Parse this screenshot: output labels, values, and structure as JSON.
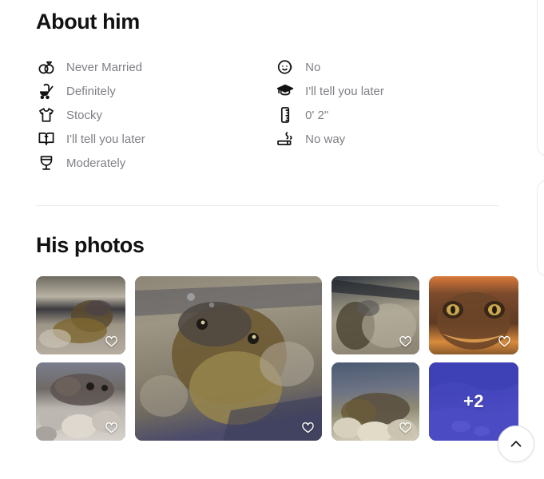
{
  "about": {
    "title": "About him",
    "facts_left": [
      {
        "icon": "wedding-rings-icon",
        "label": "Never Married"
      },
      {
        "icon": "stroller-icon",
        "label": "Definitely"
      },
      {
        "icon": "tshirt-icon",
        "label": "Stocky"
      },
      {
        "icon": "open-book-icon",
        "label": "I'll tell you later"
      },
      {
        "icon": "wine-glass-icon",
        "label": "Moderately"
      }
    ],
    "facts_right": [
      {
        "icon": "baby-face-icon",
        "label": "No"
      },
      {
        "icon": "graduation-cap-icon",
        "label": "I'll tell you later"
      },
      {
        "icon": "ruler-icon",
        "label": "0' 2\""
      },
      {
        "icon": "cigarette-icon",
        "label": "No way"
      }
    ]
  },
  "photos": {
    "title": "His photos",
    "items": [
      {
        "name": "photo-1",
        "alt": "frog in tank",
        "like": "heart-icon"
      },
      {
        "name": "photo-2-large",
        "alt": "close up frog head",
        "like": "heart-icon"
      },
      {
        "name": "photo-3",
        "alt": "frog near gravel",
        "like": "heart-icon"
      },
      {
        "name": "photo-4",
        "alt": "orange toad face",
        "like": "heart-icon"
      },
      {
        "name": "photo-5",
        "alt": "frog on white pebbles",
        "like": "heart-icon"
      },
      {
        "name": "photo-6",
        "alt": "frog under water",
        "like": "heart-icon"
      }
    ],
    "more_count_label": "+2",
    "more_overlay_color": "#2d2ad6"
  },
  "fab": {
    "icon": "chevron-up-icon",
    "tooltip": "Scroll to top"
  },
  "colors": {
    "heading": "#121212",
    "muted_text": "#808086",
    "divider": "#ededf0",
    "accent_blue": "#2d2ad6"
  }
}
